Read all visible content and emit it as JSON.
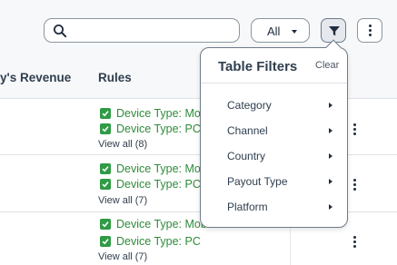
{
  "toolbar": {
    "search_placeholder": "",
    "select_value": "All"
  },
  "table": {
    "columns": [
      "y's Revenue",
      "Rules"
    ],
    "rows": [
      {
        "rules": [
          "Device Type: Mobi",
          "Device Type: PC"
        ],
        "view_all": "View all (8)"
      },
      {
        "rules": [
          "Device Type: Mobi",
          "Device Type: PC"
        ],
        "view_all": "View all (7)"
      },
      {
        "rules": [
          "Device Type: Mobi",
          "Device Type: PC"
        ],
        "view_all": "View all (7)"
      }
    ]
  },
  "filters_popover": {
    "title": "Table Filters",
    "clear_label": "Clear",
    "items": [
      "Category",
      "Channel",
      "Country",
      "Payout Type",
      "Platform"
    ]
  },
  "colors": {
    "rule_green": "#2e8b3a",
    "check_green": "#2f9b45",
    "header_bg": "#f7f8fa"
  }
}
